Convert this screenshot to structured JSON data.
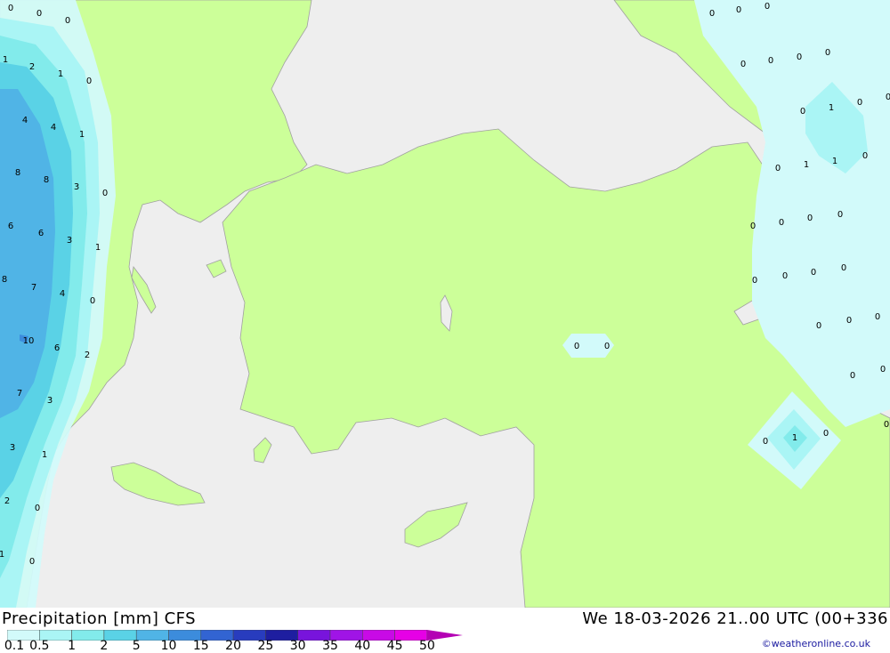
{
  "map": {
    "title": "Precipitation [mm] CFS",
    "datetime": "We 18-03-2026 21..00 UTC (00+336",
    "credit": "©weatheronline.co.uk",
    "colors": {
      "sea": "#eeeeee",
      "land": "#ccff99",
      "coast": "#a0a0a0"
    },
    "precip_labels": [
      "0",
      "0",
      "0",
      "1",
      "2",
      "1",
      "0",
      "4",
      "4",
      "1",
      "8",
      "8",
      "3",
      "0",
      "6",
      "6",
      "3",
      "1",
      "8",
      "7",
      "4",
      "0",
      "10",
      "6",
      "2",
      "7",
      "3",
      "3",
      "1",
      "2",
      "0",
      "1",
      "0",
      "0",
      "0",
      "0",
      "0",
      "0",
      "0",
      "0",
      "0",
      "1",
      "0",
      "0",
      "0",
      "1",
      "1",
      "0",
      "0",
      "0",
      "0",
      "0",
      "0",
      "0",
      "0",
      "0",
      "0",
      "0",
      "0",
      "0",
      "0",
      "0",
      "1",
      "0",
      "0",
      "0",
      "0"
    ]
  },
  "legend": {
    "labels": [
      "0.1",
      "0.5",
      "1",
      "2",
      "5",
      "10",
      "15",
      "20",
      "25",
      "30",
      "35",
      "40",
      "45",
      "50"
    ],
    "colors": [
      "#d2fafa",
      "#aaf5f5",
      "#82ebeb",
      "#5ad2e6",
      "#50b4e6",
      "#3c8cdc",
      "#3264d2",
      "#283cbe",
      "#1e1ea0",
      "#7814dc",
      "#a014e6",
      "#c80ae6",
      "#e600e6",
      "#b400b4"
    ]
  }
}
